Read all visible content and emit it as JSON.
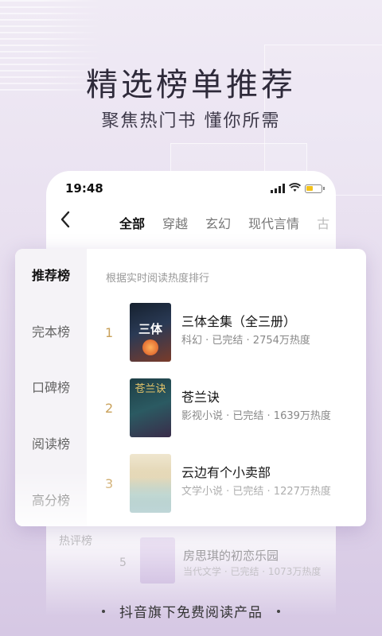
{
  "banner": {
    "headline": "精选榜单推荐",
    "subline": "聚焦热门书 懂你所需"
  },
  "status_bar": {
    "time": "19:48",
    "battery_color": "#f3c21a"
  },
  "nav": {
    "back_icon": "chevron-left-icon",
    "tabs": [
      {
        "label": "全部",
        "active": true
      },
      {
        "label": "穿越"
      },
      {
        "label": "玄幻"
      },
      {
        "label": "现代言情"
      },
      {
        "label": "古"
      }
    ]
  },
  "panel": {
    "hint": "根据实时阅读热度排行",
    "side_items": [
      {
        "label": "推荐榜",
        "active": true
      },
      {
        "label": "完本榜"
      },
      {
        "label": "口碑榜"
      },
      {
        "label": "阅读榜"
      },
      {
        "label": "高分榜"
      }
    ],
    "books": [
      {
        "rank": "1",
        "title": "三体全集（全三册）",
        "meta": "科幻 · 已完结 · 2754万热度",
        "cover_text": "三体"
      },
      {
        "rank": "2",
        "title": "苍兰诀",
        "meta": "影视小说 · 已完结 · 1639万热度",
        "cover_text": "苍兰诀"
      },
      {
        "rank": "3",
        "title": "云边有个小卖部",
        "meta": "文学小说 · 已完结 · 1227万热度"
      }
    ]
  },
  "background_list": {
    "side_label": "热评榜",
    "book": {
      "rank": "5",
      "title": "房思琪的初恋乐园",
      "meta": "当代文学 · 已完结 · 1073万热度"
    }
  },
  "footer": {
    "text": "抖音旗下免费阅读产品"
  },
  "colors": {
    "accent_rank": "#c9a15a",
    "background": "#e7deef"
  }
}
